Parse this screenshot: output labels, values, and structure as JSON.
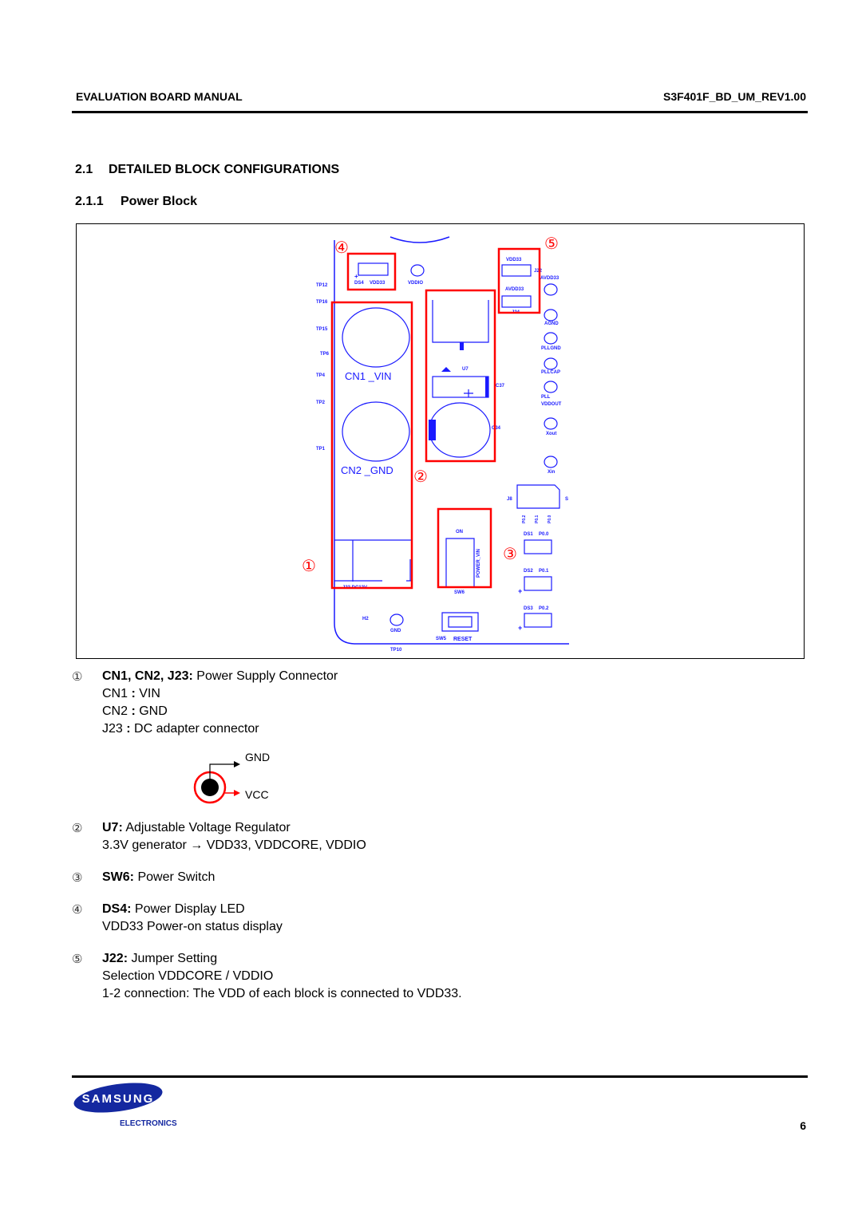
{
  "header": {
    "left": "EVALUATION BOARD MANUAL",
    "right": "S3F401F_BD_UM_REV1.00"
  },
  "section": {
    "number": "2.1",
    "title": "DETAILED BLOCK CONFIGURATIONS"
  },
  "subsection": {
    "number": "2.1.1",
    "title": "Power Block"
  },
  "board": {
    "callouts": [
      "①",
      "②",
      "③",
      "④",
      "⑤"
    ],
    "test_points": [
      "TP12",
      "TP16",
      "TP15",
      "TP6",
      "TP4",
      "TP2",
      "TP1",
      "TP10"
    ],
    "labels": {
      "ds4": "DS4",
      "vdd33": "VDD33",
      "vddio": "VDDIO",
      "cn1": "CN1 _VIN",
      "cn2": "CN2 _GND",
      "u7": "U7",
      "c37": "C37",
      "c34": "C34",
      "j22_vdd33": "VDD33",
      "j22": "J22",
      "j22_avdd33": "AVDD33",
      "j24": "J24",
      "avdd33": "AVDD33",
      "agnd": "AGND",
      "pllgnd": "PLLGND",
      "pllcap": "PLLCAP",
      "pll": "PLL",
      "vddout": "VDDOUT",
      "xout": "Xout",
      "xin": "Xin",
      "j8": "J8",
      "j8_right": "S",
      "p02": "P0.2",
      "p01": "P0.1",
      "p00": "P0.0",
      "ds1": "DS1",
      "ds1_pin": "P0.0",
      "ds2": "DS2",
      "ds2_pin": "P0.1",
      "ds3": "DS3",
      "ds3_pin": "P0.2",
      "on": "ON",
      "power_vin": "POWER_VIN",
      "sw6": "SW6",
      "j23": "J23  DC12V",
      "h2": "H2",
      "gnd": "GND",
      "sw5": "SW5",
      "reset": "RESET"
    }
  },
  "items": [
    {
      "marker": "①",
      "title": "CN1, CN2, J23:",
      "text": " Power Supply Connector",
      "lines": [
        {
          "key": "CN1",
          "sep": " : ",
          "val": "VIN"
        },
        {
          "key": "CN2",
          "sep": " : ",
          "val": "GND"
        },
        {
          "key": "J23",
          "sep": " : ",
          "val": "DC adapter connector"
        }
      ]
    },
    {
      "marker": "②",
      "title": "U7:",
      "text": " Adjustable Voltage Regulator",
      "line": "3.3V generator → VDD33, VDDCORE, VDDIO"
    },
    {
      "marker": "③",
      "title": "SW6:",
      "text": " Power Switch"
    },
    {
      "marker": "④",
      "title": "DS4:",
      "text": " Power Display LED",
      "line": "VDD33 Power-on status display"
    },
    {
      "marker": "⑤",
      "title": "J22:",
      "text": " Jumper Setting",
      "line": "Selection VDDCORE / VDDIO",
      "line2": "1-2 connection: The VDD of each block is connected to VDD33."
    }
  ],
  "dc_jack": {
    "gnd": "GND",
    "vcc": "VCC"
  },
  "footer": {
    "logo_text": "SAMSUNG",
    "logo_sub": "ELECTRONICS",
    "page_number": "6",
    "brand_color": "#1428a0"
  }
}
